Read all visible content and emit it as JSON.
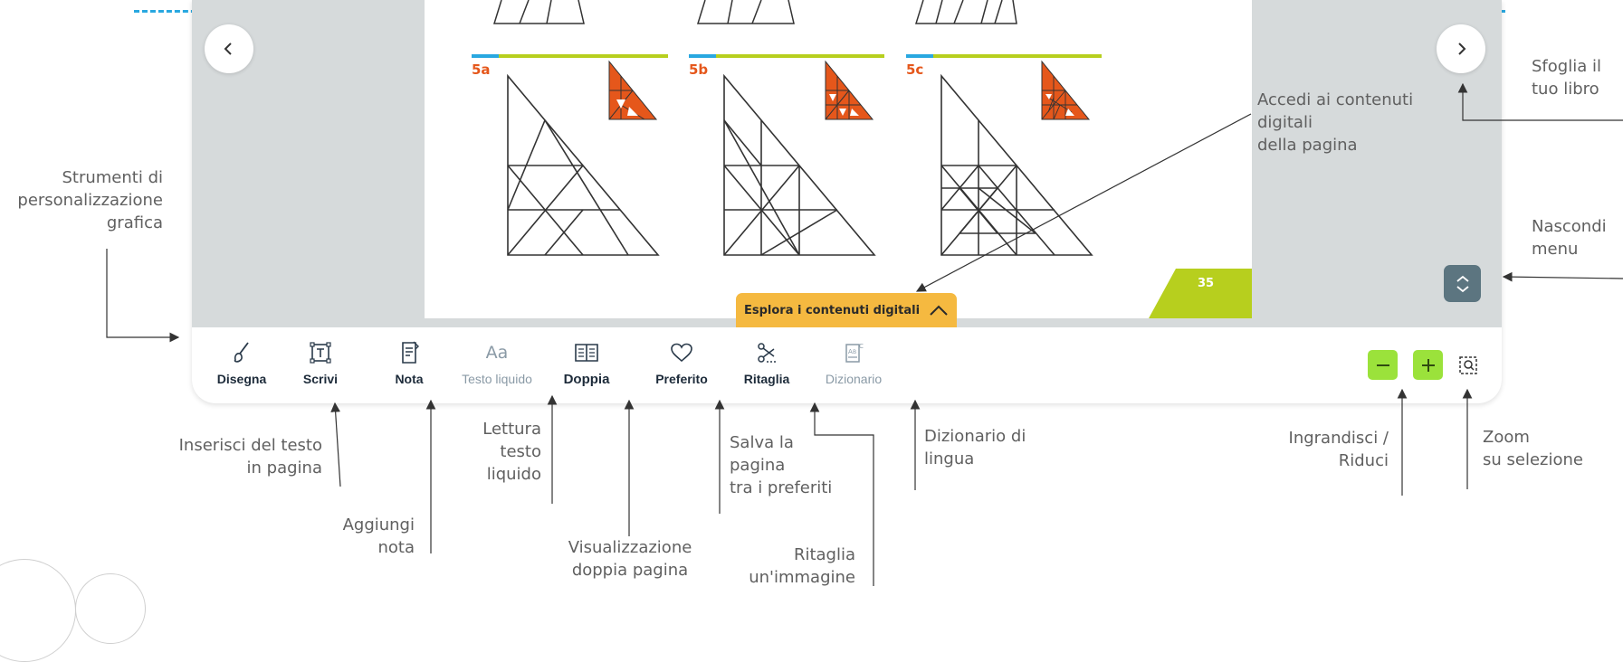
{
  "page_labels": {
    "fig_5a": "5a",
    "fig_5b": "5b",
    "fig_5c": "5c",
    "page_number": "35"
  },
  "navigation": {
    "prev_icon": "chevron-left",
    "next_icon": "chevron-right",
    "hide_menu_icon": "chevron-up-down"
  },
  "explore": {
    "label": "Esplora i contenuti digitali",
    "icon": "chevron-up"
  },
  "toolbar": {
    "tools": [
      {
        "label": "Disegna",
        "icon": "brush-icon"
      },
      {
        "label": "Scrivi",
        "icon": "text-frame-icon"
      },
      {
        "label": "Nota",
        "icon": "note-icon"
      },
      {
        "label": "Testo liquido",
        "icon": "font-aa-icon"
      },
      {
        "label": "Doppia",
        "icon": "open-book-icon"
      },
      {
        "label": "Preferito",
        "icon": "heart-icon"
      },
      {
        "label": "Ritaglia",
        "icon": "scissors-icon"
      },
      {
        "label": "Dizionario",
        "icon": "dictionary-icon"
      }
    ],
    "zoom_out_icon": "minus",
    "zoom_in_icon": "plus",
    "zoom_selection_icon": "zoom-selection"
  },
  "callouts": {
    "sfoglia": "Sfoglia il\ntuo libro",
    "accedi": "Accedi ai contenuti\ndigitali\ndella pagina",
    "strumenti": "Strumenti di\npersonalizzazione\ngrafica",
    "nascondi": "Nascondi\nmenu",
    "inserisci": "Inserisci del testo\nin pagina",
    "aggiungi": "Aggiungi\nnota",
    "lettura": "Lettura\ntesto\nliquido",
    "visualizzazione": "Visualizzazione\ndoppia pagina",
    "salva": "Salva la\npagina\ntra i preferiti",
    "ritaglia": "Ritaglia\nun'immagine",
    "dizionario": "Dizionario di\nlingua",
    "ingrandisci": "Ingrandisci /\nRiduci",
    "zoom": "Zoom\nsu selezione"
  },
  "colors": {
    "accent_orange": "#f5b940",
    "zoom_green": "#9be23b",
    "dash_blue": "#29a8e0",
    "viewer_gray": "#d6dadb",
    "label_orange": "#e5571b"
  }
}
